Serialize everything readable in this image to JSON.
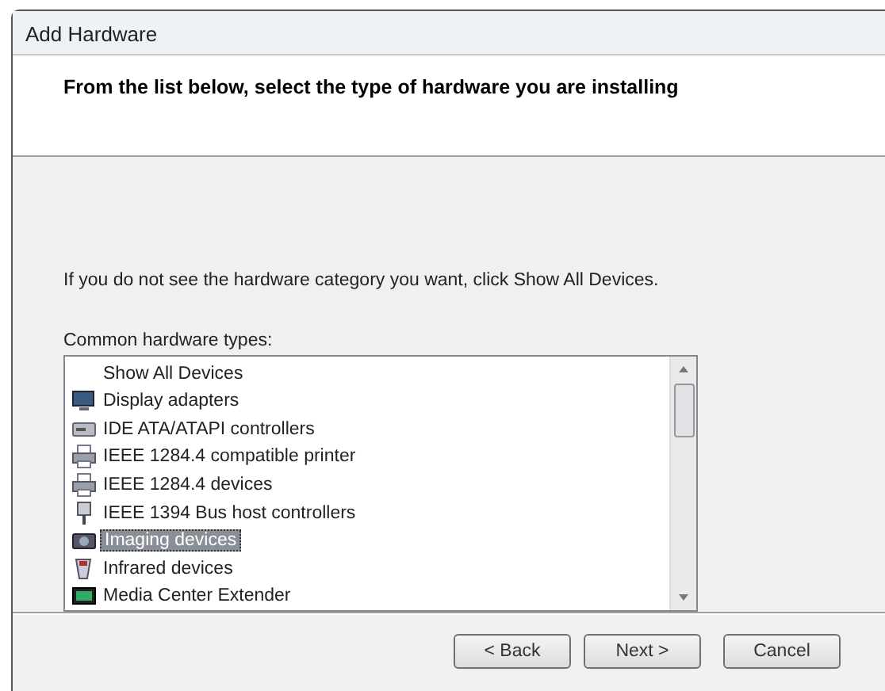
{
  "window": {
    "title": "Add Hardware"
  },
  "header": {
    "heading": "From the list below, select the type of hardware you are installing"
  },
  "instructions": "If you do not see the hardware category you want, click Show All Devices.",
  "list": {
    "label": "Common hardware types:",
    "items": [
      {
        "label": "Show All Devices",
        "kind": "none",
        "selected": false
      },
      {
        "label": "Display adapters",
        "kind": "display",
        "selected": false
      },
      {
        "label": "IDE ATA/ATAPI controllers",
        "kind": "drive",
        "selected": false
      },
      {
        "label": "IEEE 1284.4 compatible printer",
        "kind": "printer",
        "selected": false
      },
      {
        "label": "IEEE 1284.4 devices",
        "kind": "printer",
        "selected": false
      },
      {
        "label": "IEEE 1394 Bus host controllers",
        "kind": "plug",
        "selected": false
      },
      {
        "label": "Imaging devices",
        "kind": "camera",
        "selected": true
      },
      {
        "label": "Infrared devices",
        "kind": "infrared",
        "selected": false
      },
      {
        "label": "Media Center Extender",
        "kind": "media",
        "selected": false
      }
    ]
  },
  "buttons": [
    {
      "label": "< Back",
      "kind": "back"
    },
    {
      "label": "Next >",
      "kind": "next"
    },
    {
      "label": "Cancel",
      "kind": "cancel"
    }
  ]
}
